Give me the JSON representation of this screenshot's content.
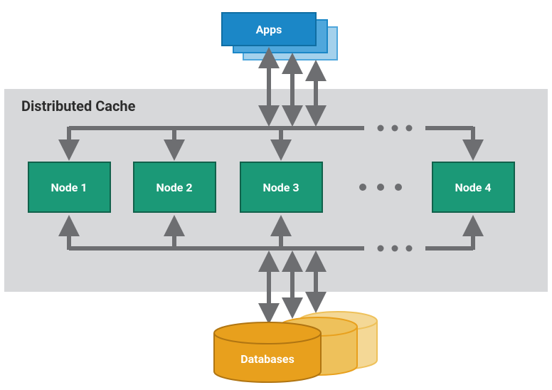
{
  "apps": {
    "label": "Apps"
  },
  "cache": {
    "title": "Distributed Cache",
    "nodes": [
      "Node 1",
      "Node 2",
      "Node 3",
      "Node 4"
    ]
  },
  "databases": {
    "label": "Databases"
  },
  "colors": {
    "appsPrimary": "#1b87c7",
    "appsShadow1": "#4fa7dc",
    "appsShadow2": "#a4d1ec",
    "appsStroke": "#0f6ea3",
    "cacheBg": "#d7d8da",
    "cacheTitle": "#2d2d2d",
    "nodeFill": "#1b9977",
    "nodeStroke": "#11614b",
    "dbPrimary": "#e8a01d",
    "dbShadow1": "#eec15b",
    "dbShadow2": "#f4d896",
    "dbStroke": "#b07512",
    "arrow": "#6d6e71"
  }
}
